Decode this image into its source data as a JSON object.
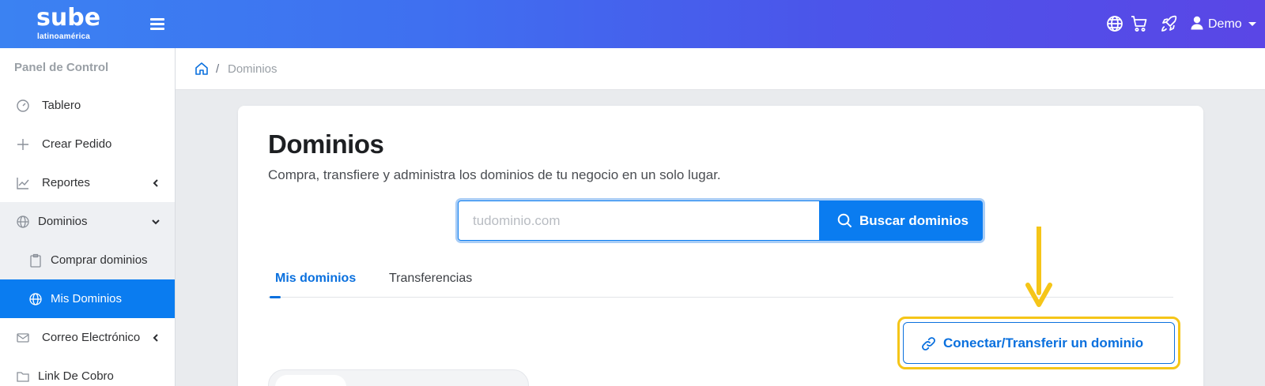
{
  "brand": {
    "logo_main": "sube",
    "logo_sub": "latinoamérica"
  },
  "header": {
    "user_label": "Demo"
  },
  "sidebar": {
    "title": "Panel de Control",
    "items": [
      {
        "label": "Tablero"
      },
      {
        "label": "Crear Pedido"
      },
      {
        "label": "Reportes"
      },
      {
        "label": "Dominios"
      },
      {
        "label": "Comprar dominios"
      },
      {
        "label": "Mis Dominios"
      },
      {
        "label": "Correo Electrónico"
      },
      {
        "label": "Link De Cobro"
      }
    ]
  },
  "breadcrumb": {
    "separator": "/",
    "current": "Dominios"
  },
  "main": {
    "title": "Dominios",
    "subtitle": "Compra, transfiere y administra los dominios de tu negocio en un solo lugar.",
    "search": {
      "placeholder": "tudominio.com",
      "button_label": "Buscar dominios"
    },
    "tabs": [
      {
        "label": "Mis dominios",
        "active": true
      },
      {
        "label": "Transferencias",
        "active": false
      }
    ],
    "connect_button_label": "Conectar/Transferir un dominio"
  },
  "colors": {
    "primary": "#0a7cf0",
    "highlight": "#f5c518",
    "header_gradient_start": "#3b82f2",
    "header_gradient_end": "#5a46e6"
  },
  "icons": [
    "menu-icon",
    "globe-icon",
    "cart-icon",
    "rocket-icon",
    "user-icon",
    "gauge-icon",
    "plus-icon",
    "chart-icon",
    "clipboard-icon",
    "mail-icon",
    "folder-icon",
    "home-icon",
    "search-icon",
    "link-icon",
    "chevron-left-icon",
    "chevron-down-icon"
  ]
}
